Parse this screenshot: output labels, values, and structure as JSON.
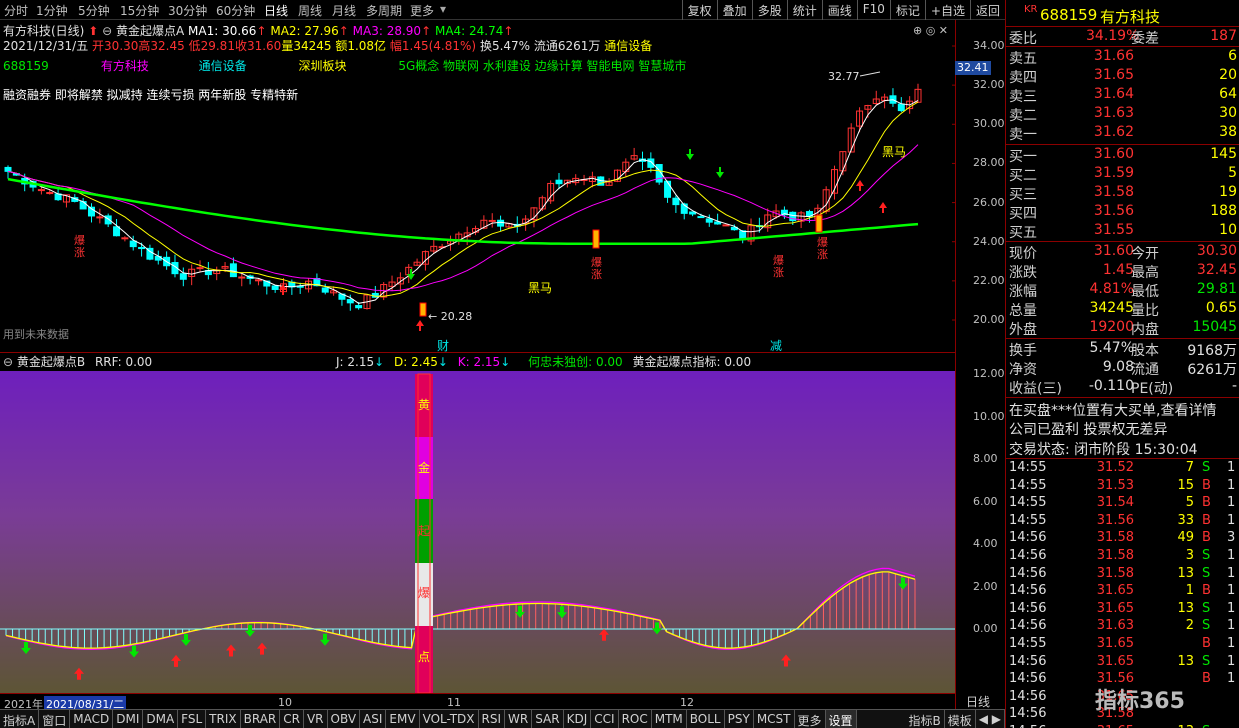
{
  "toolbar": {
    "periods": [
      "分时",
      "1分钟",
      "5分钟",
      "15分钟",
      "30分钟",
      "60分钟",
      "日线",
      "周线",
      "月线",
      "多周期",
      "更多"
    ],
    "active_period": "日线",
    "buttons": [
      "复权",
      "叠加",
      "多股",
      "统计",
      "画线",
      "F10",
      "标记",
      "+自选",
      "返回"
    ]
  },
  "main_info": {
    "name": "有方科技(日线)",
    "indicator_name": "黄金起爆点A",
    "ma1": "MA1: 30.66",
    "ma2": "MA2: 27.96",
    "ma3": "MA3: 28.90",
    "ma4": "MA4: 24.74",
    "date_line": "2021/12/31/五",
    "open": "开30.30",
    "high": "高32.45",
    "low": "低29.81",
    "close": "收31.60",
    "volume": "量34245",
    "amount": "额1.08亿",
    "change": "幅1.45(4.81%)",
    "turnover": "换5.47%",
    "float": "流通6261万",
    "industry": "通信设备",
    "code": "688159",
    "short_name": "有方科技",
    "industry2": "通信设备",
    "board": "深圳板块",
    "concepts": "5G概念 物联网 水利建设 边缘计算 智能电网 智慧城市",
    "tags": "融资融券 即将解禁 拟减持 连续亏损 两年新股 专精特新",
    "future_note": "用到未来数据",
    "label_high": "32.77",
    "label_low": "20.28",
    "label_cai": "财",
    "label_jian": "减",
    "label_heima1": "黑马",
    "label_heima2": "黑马",
    "label_bao": "爆涨",
    "current_price_tag": "32.41"
  },
  "price_axis": [
    "34.00",
    "32.00",
    "30.00",
    "28.00",
    "26.00",
    "24.00",
    "22.00",
    "20.00"
  ],
  "indicator": {
    "name": "黄金起爆点B",
    "rrf": "RRF: 0.00",
    "j": "J: 2.15",
    "d": "D: 2.45",
    "k": "K: 2.15",
    "hezhong": "何忠未独创: 0.00",
    "index": "黄金起爆点指标: 0.00",
    "bar_chars": [
      "黄",
      "金",
      "起",
      "爆",
      "点"
    ],
    "axis": [
      "12.00",
      "10.00",
      "8.00",
      "6.00",
      "4.00",
      "2.00",
      "0.00"
    ]
  },
  "datebar": {
    "year": "2021年",
    "selected": "2021/08/31/二",
    "m10": "10",
    "m11": "11",
    "m12": "12",
    "period_label": "日线"
  },
  "bottom_tabs": [
    "指标A",
    "窗口",
    "MACD",
    "DMI",
    "DMA",
    "FSL",
    "TRIX",
    "BRAR",
    "CR",
    "VR",
    "OBV",
    "ASI",
    "EMV",
    "VOL-TDX",
    "RSI",
    "WR",
    "SAR",
    "KDJ",
    "CCI",
    "ROC",
    "MTM",
    "BOLL",
    "PSY",
    "MCST",
    "更多",
    "设置"
  ],
  "bottom_right": [
    "指标B",
    "模板"
  ],
  "quote": {
    "code": "688159",
    "name": "有方科技",
    "wb_label": "委比",
    "wb": "34.19%",
    "wc_label": "委差",
    "wc": "187",
    "asks": [
      {
        "label": "卖五",
        "price": "31.66",
        "vol": "6"
      },
      {
        "label": "卖四",
        "price": "31.65",
        "vol": "20"
      },
      {
        "label": "卖三",
        "price": "31.64",
        "vol": "64"
      },
      {
        "label": "卖二",
        "price": "31.63",
        "vol": "30"
      },
      {
        "label": "卖一",
        "price": "31.62",
        "vol": "38"
      }
    ],
    "bids": [
      {
        "label": "买一",
        "price": "31.60",
        "vol": "145"
      },
      {
        "label": "买二",
        "price": "31.59",
        "vol": "5"
      },
      {
        "label": "买三",
        "price": "31.58",
        "vol": "19"
      },
      {
        "label": "买四",
        "price": "31.56",
        "vol": "188"
      },
      {
        "label": "买五",
        "price": "31.55",
        "vol": "10"
      }
    ],
    "stats": [
      {
        "l": "现价",
        "v": "31.60",
        "l2": "今开",
        "v2": "30.30"
      },
      {
        "l": "涨跌",
        "v": "1.45",
        "l2": "最高",
        "v2": "32.45"
      },
      {
        "l": "涨幅",
        "v": "4.81%",
        "l2": "最低",
        "v2": "29.81"
      },
      {
        "l": "总量",
        "v": "34245",
        "l2": "量比",
        "v2": "0.65"
      },
      {
        "l": "外盘",
        "v": "19200",
        "l2": "内盘",
        "v2": "15045"
      }
    ],
    "stats2": [
      {
        "l": "换手",
        "v": "5.47%",
        "l2": "股本",
        "v2": "9168万"
      },
      {
        "l": "净资",
        "v": "9.08",
        "l2": "流通",
        "v2": "6261万"
      },
      {
        "l": "收益(三)",
        "v": "-0.110",
        "l2": "PE(动)",
        "v2": "-"
      }
    ],
    "notice1": "在买盘***位置有大买单,查看详情",
    "notice2": "公司已盈利 投票权无差异",
    "trade_state_label": "交易状态: 闭市阶段",
    "trade_time": "15:30:04",
    "ticks": [
      {
        "t": "14:55",
        "p": "31.52",
        "q": "7",
        "s": "S",
        "n": "1"
      },
      {
        "t": "14:55",
        "p": "31.53",
        "q": "15",
        "s": "B",
        "n": "1"
      },
      {
        "t": "14:55",
        "p": "31.54",
        "q": "5",
        "s": "B",
        "n": "1"
      },
      {
        "t": "14:55",
        "p": "31.56",
        "q": "33",
        "s": "B",
        "n": "1"
      },
      {
        "t": "14:56",
        "p": "31.58",
        "q": "49",
        "s": "B",
        "n": "3"
      },
      {
        "t": "14:56",
        "p": "31.58",
        "q": "3",
        "s": "S",
        "n": "1"
      },
      {
        "t": "14:56",
        "p": "31.58",
        "q": "13",
        "s": "S",
        "n": "1"
      },
      {
        "t": "14:56",
        "p": "31.65",
        "q": "1",
        "s": "B",
        "n": "1"
      },
      {
        "t": "14:56",
        "p": "31.65",
        "q": "13",
        "s": "S",
        "n": "1"
      },
      {
        "t": "14:56",
        "p": "31.63",
        "q": "2",
        "s": "S",
        "n": "1"
      },
      {
        "t": "14:55",
        "p": "31.65",
        "q": "",
        "s": "B",
        "n": "1"
      },
      {
        "t": "14:56",
        "p": "31.65",
        "q": "13",
        "s": "S",
        "n": "1"
      },
      {
        "t": "14:56",
        "p": "31.56",
        "q": "",
        "s": "B",
        "n": "1"
      },
      {
        "t": "14:56",
        "p": "31.65",
        "q": "",
        "s": "",
        "n": ""
      },
      {
        "t": "14:56",
        "p": "31.58",
        "q": "",
        "s": "",
        "n": ""
      },
      {
        "t": "14:56",
        "p": "31.65",
        "q": "13",
        "s": "S",
        "n": ""
      }
    ],
    "watermark": "指标365"
  },
  "colors": {
    "up": "#ff3232",
    "down": "#00ffff",
    "ma1": "#ffffff",
    "ma2": "#ffff00",
    "ma3": "#ff00ff",
    "ma4": "#00ff00",
    "panel_border": "#8b0000"
  }
}
